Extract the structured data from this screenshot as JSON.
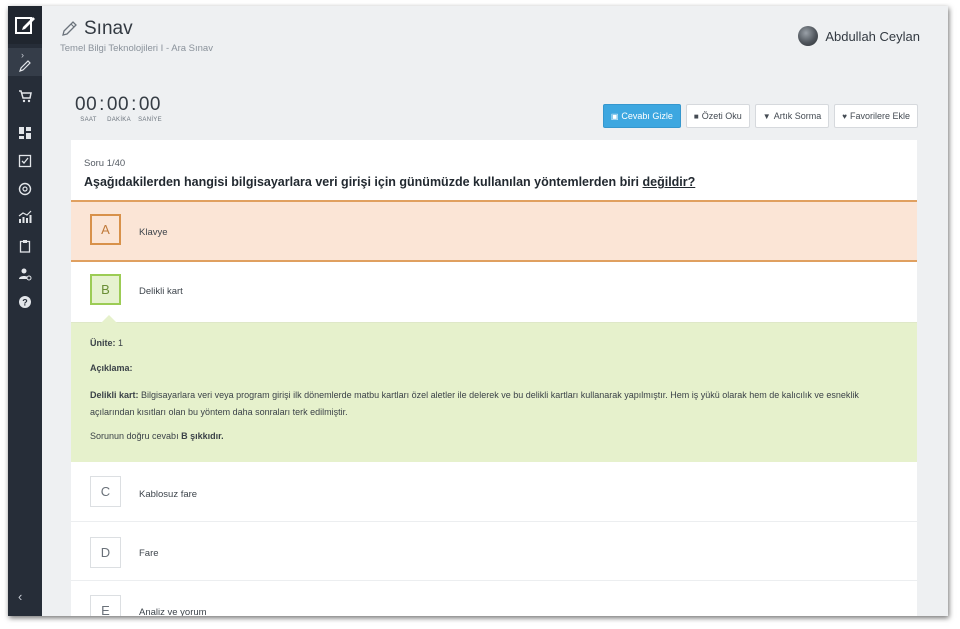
{
  "header": {
    "title": "Sınav",
    "subtitle": "Temel Bilgi Teknolojileri I - Ara Sınav",
    "user_name": "Abdullah Ceylan"
  },
  "timer": {
    "hours": "00",
    "minutes": "00",
    "seconds": "00",
    "hours_label": "SAAT",
    "minutes_label": "DAKİKA",
    "seconds_label": "SANİYE"
  },
  "actions": {
    "hide_answer": "Cevabı Gizle",
    "read_summary": "Özeti Oku",
    "dont_ask": "Artık Sorma",
    "add_favorites": "Favorilere Ekle"
  },
  "question": {
    "number": "Soru 1/40",
    "text_main": "Aşağıdakilerden hangisi bilgisayarlara veri girişi için günümüzde kullanılan yöntemlerden biri ",
    "text_emphasis": "değildir?"
  },
  "options": [
    {
      "letter": "A",
      "text": "Klavye"
    },
    {
      "letter": "B",
      "text": "Delikli kart"
    },
    {
      "letter": "C",
      "text": "Kablosuz fare"
    },
    {
      "letter": "D",
      "text": "Fare"
    },
    {
      "letter": "E",
      "text": "Analiz ve yorum"
    }
  ],
  "explanation": {
    "unit_label": "Ünite:",
    "unit_value": "1",
    "heading": "Açıklama:",
    "term": "Delikli kart:",
    "body": "Bilgisayarlara veri veya program girişi ilk dönemlerde matbu kartları özel aletler ile delerek ve bu delikli kartları kullanarak yapılmıştır. Hem iş yükü olarak hem de kalıcılık ve esneklik açılarından kısıtları olan bu yöntem daha sonraları terk edilmiştir.",
    "answer_prefix": "Sorunun doğru cevabı",
    "answer_value": "B şıkkıdır."
  },
  "colors": {
    "sidebar": "#262d38",
    "primary_button": "#3da7e0",
    "selected_wrong_bg": "#fbe5d6",
    "selected_wrong_border": "#d8914a",
    "correct_bg": "#e6f1cc",
    "correct_border": "#9ccc55"
  },
  "sidebar_icons": [
    "edit-logo-icon",
    "expand-chevron-icon",
    "pencil-icon",
    "cart-icon",
    "dashboard-icon",
    "checklist-icon",
    "help-circle-icon",
    "stats-icon",
    "clipboard-icon",
    "user-settings-icon",
    "question-icon",
    "collapse-chevron-icon"
  ]
}
